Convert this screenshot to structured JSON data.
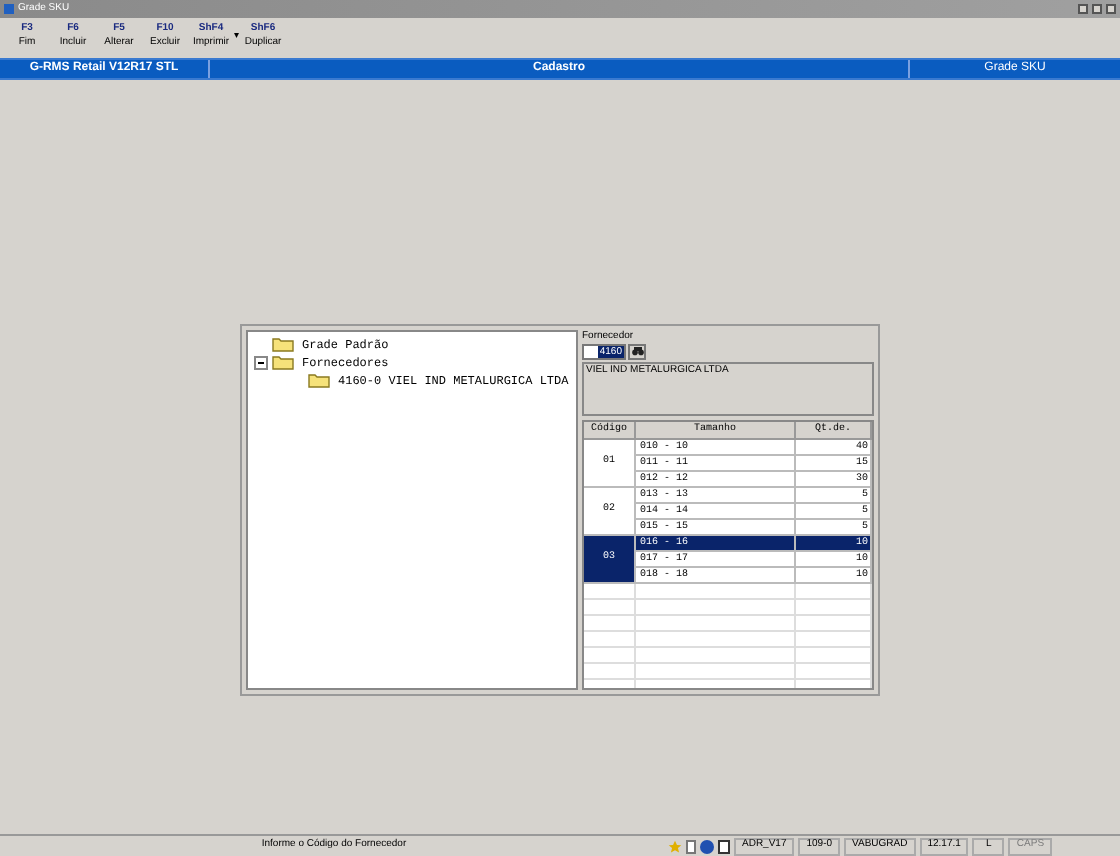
{
  "window": {
    "title": "Grade SKU"
  },
  "toolbar": [
    {
      "key": "F3",
      "label": "Fim"
    },
    {
      "key": "F6",
      "label": "Incluir"
    },
    {
      "key": "F5",
      "label": "Alterar"
    },
    {
      "key": "F10",
      "label": "Excluir"
    },
    {
      "key": "ShF4",
      "label": "Imprimir",
      "caret": "▾"
    },
    {
      "key": "ShF6",
      "label": "Duplicar"
    }
  ],
  "header": [
    "G-RMS Retail V12R17 STL",
    "Cadastro",
    "Grade SKU"
  ],
  "tree": [
    {
      "label": "Grade Padrão"
    },
    {
      "label": "Fornecedores",
      "expanded": true,
      "children": [
        {
          "label": "4160-0 VIEL IND METALURGICA LTDA"
        }
      ]
    }
  ],
  "supplier": {
    "label": "Fornecedor",
    "value": "4160",
    "name": "VIEL IND METALURGICA LTDA"
  },
  "grid": {
    "columns": [
      "Código",
      "Tamanho",
      "Qt.de."
    ],
    "groups": [
      {
        "code": "01",
        "selected": false,
        "rows": [
          {
            "size": "010 - 10",
            "qty": "40",
            "selected": false
          },
          {
            "size": "011 - 11",
            "qty": "15",
            "selected": false
          },
          {
            "size": "012 - 12",
            "qty": "30",
            "selected": false
          }
        ]
      },
      {
        "code": "02",
        "selected": false,
        "rows": [
          {
            "size": "013 - 13",
            "qty": "5",
            "selected": false
          },
          {
            "size": "014 - 14",
            "qty": "5",
            "selected": false
          },
          {
            "size": "015 - 15",
            "qty": "5",
            "selected": false
          }
        ]
      },
      {
        "code": "03",
        "selected": true,
        "rows": [
          {
            "size": "016 - 16",
            "qty": "10",
            "selected": true
          },
          {
            "size": "017 - 17",
            "qty": "10",
            "selected": false
          },
          {
            "size": "018 - 18",
            "qty": "10",
            "selected": false
          }
        ]
      }
    ]
  },
  "status_bar": {
    "message": "Informe o Código do Fornecedor",
    "panels": [
      {
        "text": "ADR_V17",
        "disabled": false
      },
      {
        "text": "109-0",
        "disabled": false
      },
      {
        "text": "VABUGRAD",
        "disabled": false
      },
      {
        "text": "12.17.1",
        "disabled": false
      },
      {
        "text": "L",
        "disabled": false
      },
      {
        "text": "CAPS",
        "disabled": true
      }
    ]
  }
}
